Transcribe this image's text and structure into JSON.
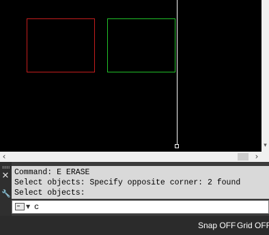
{
  "canvas": {
    "background": "#000000",
    "shapes": [
      {
        "name": "red-rectangle",
        "color": "#c81e1e"
      },
      {
        "name": "green-rectangle",
        "color": "#22c32a"
      }
    ]
  },
  "command_history": [
    "Command: E ERASE",
    "Select objects: Specify opposite corner: 2 found",
    "Select objects:"
  ],
  "command_input": {
    "value": "c"
  },
  "status_bar": {
    "snap_label": "Snap OFF",
    "grid_label": "Grid OFF"
  }
}
